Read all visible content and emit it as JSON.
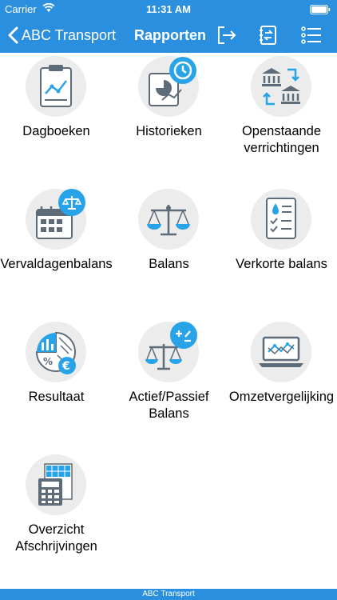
{
  "status": {
    "carrier": "Carrier",
    "time": "11:31 AM"
  },
  "navbar": {
    "back_label": "ABC Transport",
    "title": "Rapporten",
    "icons": [
      "logout-icon",
      "ledger-switch-icon",
      "menu-list-icon"
    ]
  },
  "reports": [
    {
      "label": "Dagboeken",
      "icon": "journal-clipboard-icon"
    },
    {
      "label": "Historieken",
      "icon": "history-icon"
    },
    {
      "label": "Openstaande verrichtingen",
      "icon": "bank-transfer-icon"
    },
    {
      "label": "Vervaldagenbalans",
      "icon": "calendar-scale-icon"
    },
    {
      "label": "Balans",
      "icon": "scale-icon"
    },
    {
      "label": "Verkorte balans",
      "icon": "checklist-icon"
    },
    {
      "label": "Resultaat",
      "icon": "result-euro-icon"
    },
    {
      "label": "Actief/Passief Balans",
      "icon": "plus-minus-scale-icon"
    },
    {
      "label": "Omzetvergelijking",
      "icon": "laptop-chart-icon"
    },
    {
      "label": "Overzicht Afschrijvingen",
      "icon": "calculator-icon"
    }
  ],
  "footer": {
    "text": "ABC Transport"
  },
  "colors": {
    "accent": "#2B8FE0",
    "tile_bg": "#ECECEC",
    "icon_grey": "#5E6B78",
    "icon_blue": "#29A3E8"
  }
}
